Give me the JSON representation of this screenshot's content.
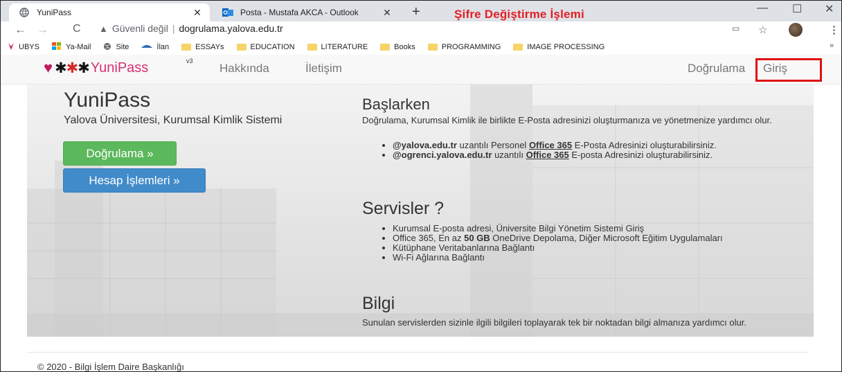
{
  "browser": {
    "tabs": [
      {
        "title": "YuniPass",
        "close": "✕"
      },
      {
        "title": "Posta - Mustafa AKCA - Outlook",
        "close": "✕"
      }
    ],
    "new_tab": "+",
    "annotation": "Şifre Değiştirme İşlemi",
    "window_controls": {
      "minimize": "—",
      "maximize": "☐",
      "close": "✕"
    },
    "nav": {
      "back": "←",
      "forward": "→",
      "reload": "C"
    },
    "security_label": "Güvenli değil",
    "url": "dogrulama.yalova.edu.tr",
    "bookmarks": [
      "UBYS",
      "Ya-Mail",
      "Site",
      "İlan",
      "ESSAYs",
      "EDUCATION",
      "LITERATURE",
      "Books",
      "PROGRAMMING",
      "IMAGE PROCESSING"
    ],
    "bookmarks_more": "»"
  },
  "site": {
    "brand": {
      "name": "YuniPass",
      "version": "v3"
    },
    "nav_left": [
      "Hakkında",
      "İletişim"
    ],
    "nav_right": [
      "Doğrulama",
      "Giriş"
    ]
  },
  "hero": {
    "title": "YuniPass",
    "subtitle": "Yalova Üniversitesi, Kurumsal Kimlik Sistemi",
    "btn_verify": "Doğrulama »",
    "btn_account": "Hesap İşlemleri »"
  },
  "baslarken": {
    "title": "Başlarken",
    "text": "Doğrulama, Kurumsal Kimlik ile birlikte E-Posta adresinizi oluşturmanıza ve yönetmenize yardımcı olur.",
    "items": [
      {
        "domain": "@yalova.edu.tr",
        "pre": " uzantılı Personel ",
        "link": "Office 365",
        "post": " E-Posta Adresinizi oluşturabilirsiniz."
      },
      {
        "domain": "@ogrenci.yalova.edu.tr",
        "pre": " uzantılı ",
        "link": "Office 365",
        "post": " E-posta Adresinizi oluşturabilirsiniz."
      }
    ]
  },
  "servisler": {
    "title": "Servisler ?",
    "items": [
      "Kurumsal E-posta adresi, Üniversite Bilgi Yönetim Sistemi Giriş",
      {
        "pre": "Office 365, En az ",
        "bold": "50 GB",
        "post": " OneDrive Depolama, Diğer Microsoft Eğitim Uygulamaları"
      },
      "Kütüphane Veritabanlarına Bağlantı",
      "Wi-Fi Ağlarına Bağlantı"
    ]
  },
  "bilgi": {
    "title": "Bilgi",
    "text": "Sunulan servislerden sizinle ilgili bilgileri toplayarak tek bir noktadan bilgi almanıza yardımcı olur."
  },
  "footer": {
    "text": "© 2020 - Bilgi İşlem Daire Başkanlığı"
  }
}
